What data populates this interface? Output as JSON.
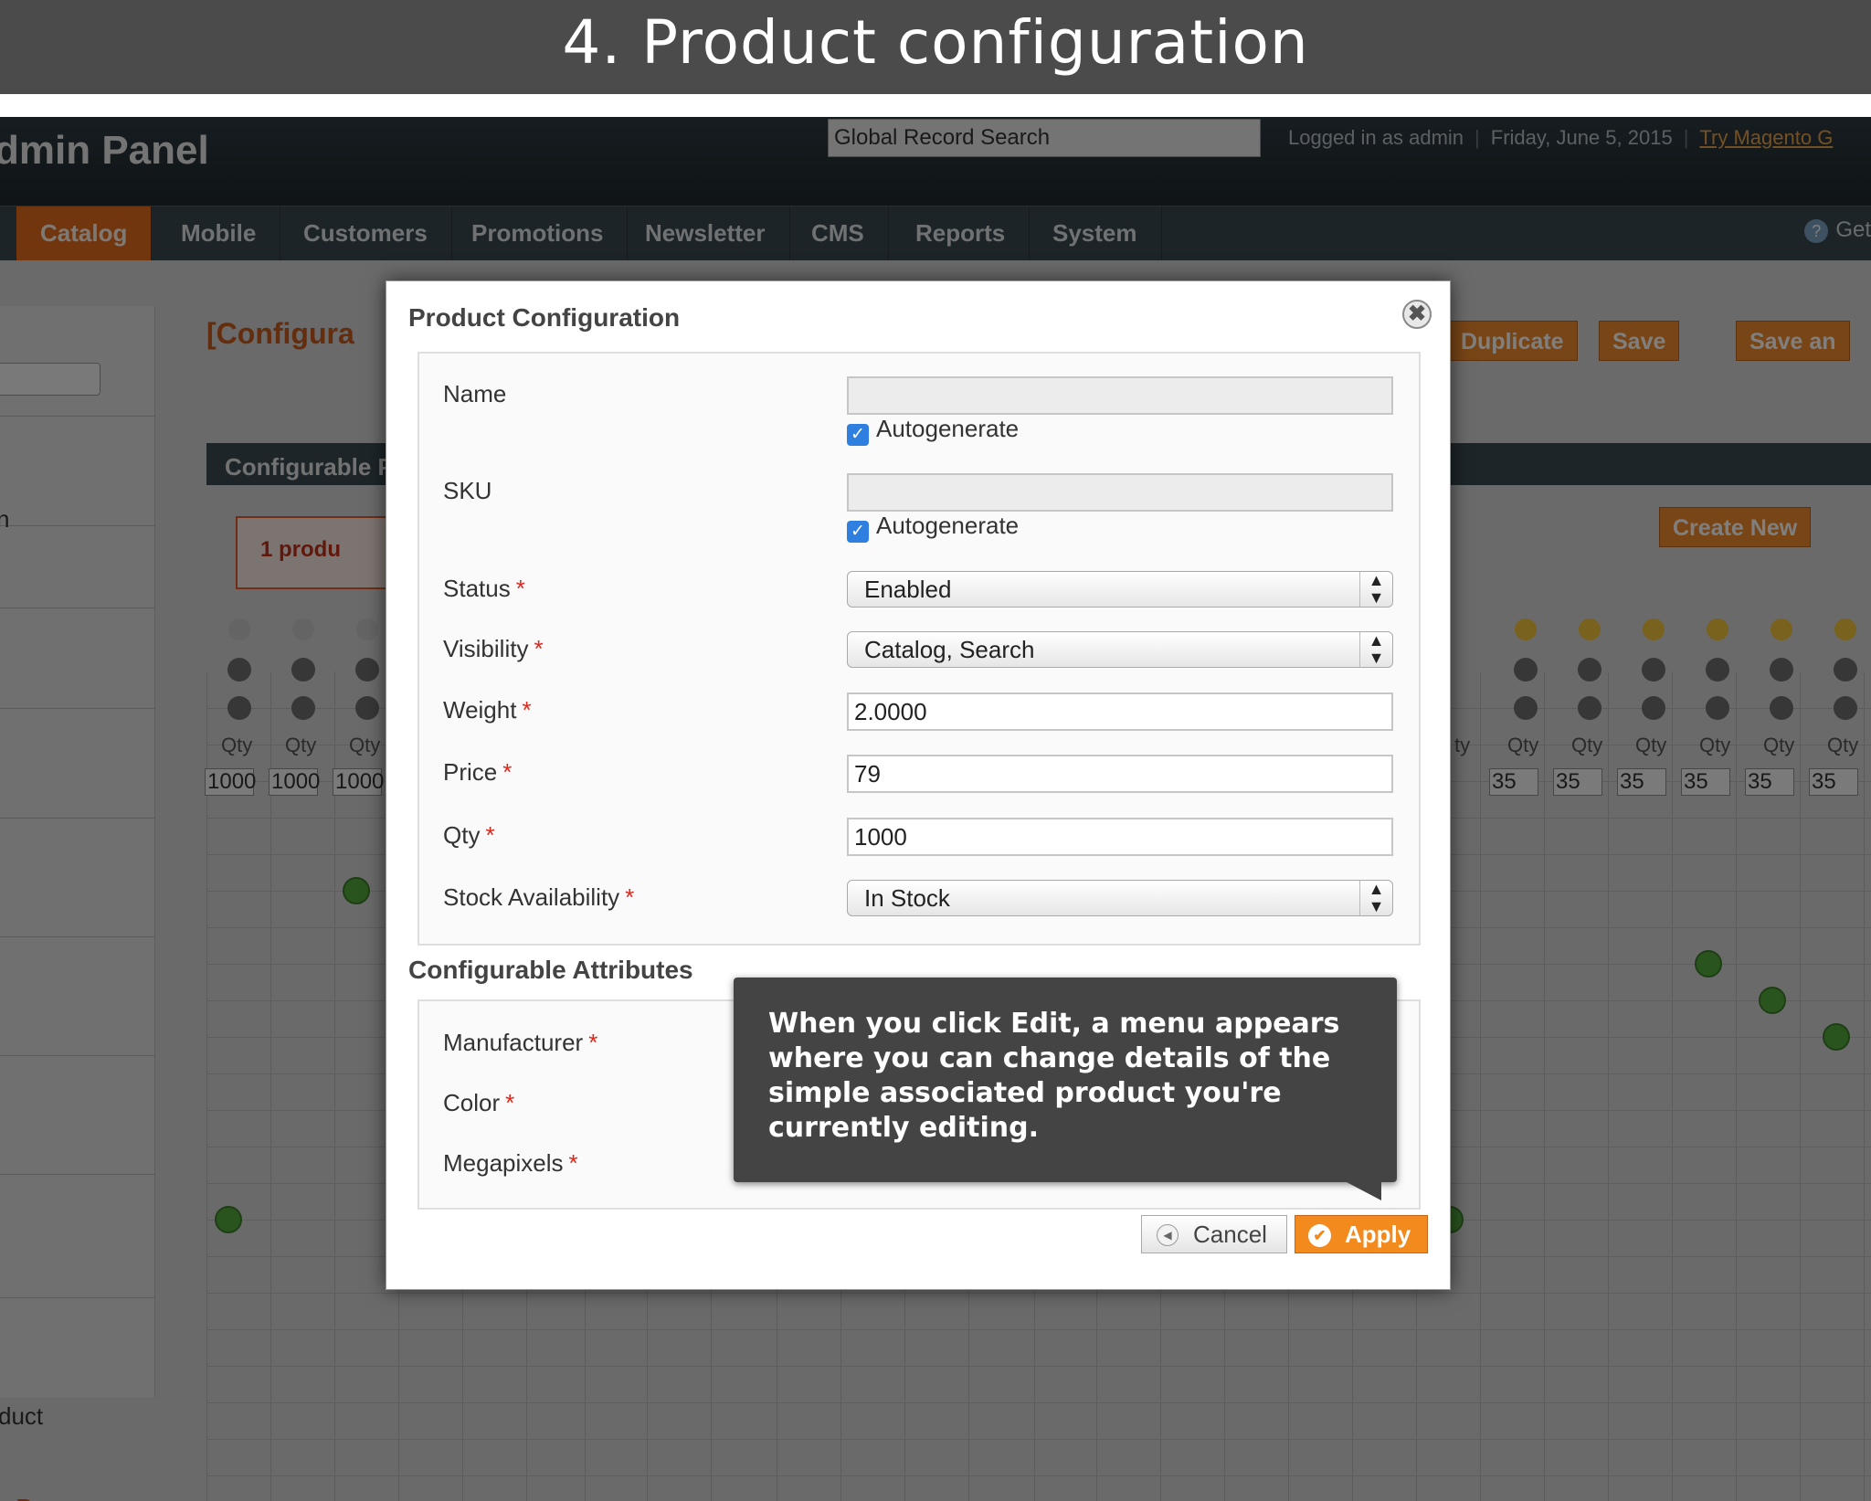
{
  "banner": {
    "title": "4.  Product configuration"
  },
  "app": {
    "title": "dmin Panel",
    "search_placeholder": "Global Record Search",
    "logged_in": "Logged in as admin",
    "date": "Friday, June 5, 2015",
    "try_link": "Try Magento G",
    "nav": [
      "Catalog",
      "Mobile",
      "Customers",
      "Promotions",
      "Newsletter",
      "CMS",
      "Reports",
      "System"
    ],
    "nav_help": "Get",
    "page_heading": "[Configura",
    "section_title": "Configurable P",
    "message": "1 produ",
    "buttons": {
      "duplicate": "Duplicate",
      "save": "Save",
      "save_and": "Save an",
      "create_new": "Create New"
    },
    "left_texts": [
      "n",
      "duct",
      "s Pro"
    ],
    "qty_label": "Qty",
    "qty_left": [
      "1000",
      "1000",
      "1000"
    ],
    "qty_right_partial": "ty",
    "qty_right": [
      "35",
      "35",
      "35",
      "35",
      "35",
      "35"
    ]
  },
  "modal": {
    "title": "Product Configuration",
    "close_glyph": "✖",
    "fields": {
      "name_label": "Name",
      "name_value": "",
      "autogenerate": "Autogenerate",
      "sku_label": "SKU",
      "sku_value": "",
      "status_label": "Status",
      "status_value": "Enabled",
      "visibility_label": "Visibility",
      "visibility_value": "Catalog, Search",
      "weight_label": "Weight",
      "weight_value": "2.0000",
      "price_label": "Price",
      "price_value": "79",
      "qty_label": "Qty",
      "qty_value": "1000",
      "stock_label": "Stock Availability",
      "stock_value": "In Stock"
    },
    "required_mark": "*",
    "attrs_heading": "Configurable Attributes",
    "attrs": {
      "manufacturer": "Manufacturer",
      "color": "Color",
      "megapixels": "Megapixels"
    },
    "cancel": "Cancel",
    "apply": "Apply"
  },
  "tooltip": {
    "text": "When you click Edit, a menu appears where you can change details of the simple associated product you're currently editing."
  }
}
